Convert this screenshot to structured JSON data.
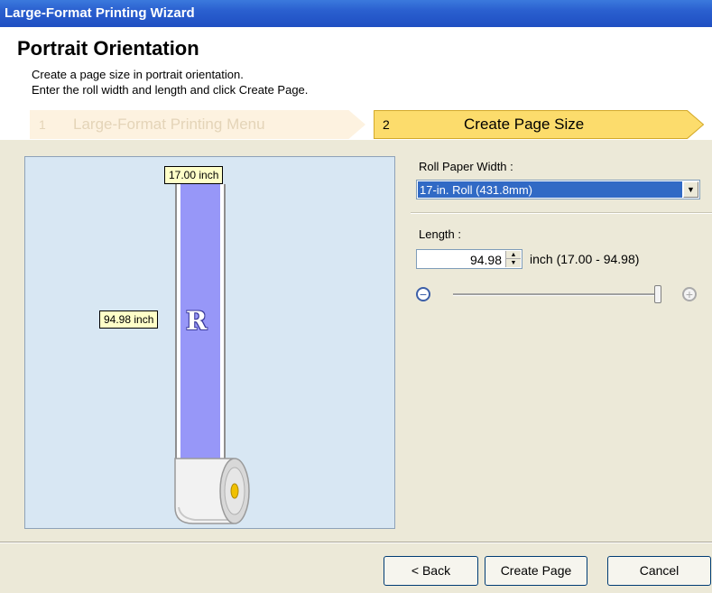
{
  "window": {
    "title": "Large-Format Printing Wizard"
  },
  "header": {
    "title": "Portrait Orientation",
    "description_line1": "Create a page size in portrait orientation.",
    "description_line2": "Enter the roll width and length and click Create Page."
  },
  "steps": [
    {
      "number": "1",
      "label": "Large-Format Printing Menu",
      "active": false
    },
    {
      "number": "2",
      "label": "Create Page Size",
      "active": true
    }
  ],
  "preview": {
    "width_label": "17.00 inch",
    "length_label": "94.98 inch",
    "glyph": "R"
  },
  "roll_paper_width": {
    "label": "Roll Paper Width :",
    "selected": "17-in. Roll (431.8mm)"
  },
  "length": {
    "label": "Length :",
    "value": "94.98",
    "unit_range": "inch  (17.00 - 94.98)",
    "slider_fraction": 1.0
  },
  "buttons": {
    "back": "< Back",
    "create_page": "Create Page",
    "cancel": "Cancel"
  },
  "colors": {
    "title_bar": "#2a5fcf",
    "active_step": "#fcdc6c",
    "inactive_step": "#fdf2e0",
    "paper_fill": "#9797f8",
    "selection": "#316ac5",
    "preview_bg": "#d8e7f3"
  }
}
